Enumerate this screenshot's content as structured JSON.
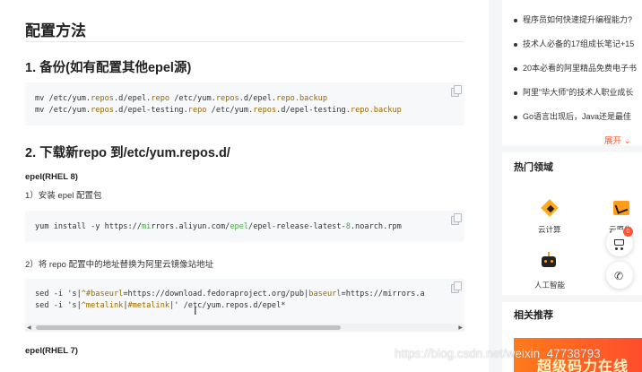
{
  "article": {
    "section_title": "配置方法",
    "backup_heading": "1. 备份(如有配置其他epel源)",
    "download_heading": "2. 下载新repo 到/etc/yum.repos.d/",
    "epel8_label": "epel(RHEL 8)",
    "step1_text": "1）安装 epel 配置包",
    "step2_text": "2）将 repo 配置中的地址替换为阿里云镜像站地址",
    "epel7_label": "epel(RHEL 7)"
  },
  "code_blocks": {
    "backup": {
      "line1": [
        "mv /etc/yum.",
        "repos",
        ".d/epel.",
        "repo",
        " /etc/yum.",
        "repos",
        ".d/epel.",
        "repo",
        ".backup"
      ],
      "line2": [
        "mv /etc/yum.",
        "repos",
        ".d/epel-testing.",
        "repo",
        " /etc/yum.",
        "repos",
        ".d/epel-testing.",
        "repo",
        ".backup"
      ]
    },
    "install": {
      "line1": [
        "yum install -y https://",
        "mi",
        "rrors.aliyun.com/",
        "epel",
        "/epel-release-latest-",
        "8",
        ".noarch.rpm"
      ]
    },
    "sed": {
      "line1": [
        "sed -i 's|",
        "^#baseurl",
        "=https://download.fedoraproject.org/pub|",
        "baseurl",
        "=https://mirrors.a"
      ],
      "line2": [
        "sed -i 's|",
        "^metalink",
        "|",
        "#metalink",
        "|' ",
        "/etc/yum.repos.d/epel*"
      ]
    }
  },
  "sidebar": {
    "recommended_items": [
      "程序员如何快速提升编程能力?",
      "技术人必备的17组成长笔记+15",
      "20本必看的阿里精品免费电子书",
      "阿里\"毕大师\"的技术人职业成长",
      "Go语言出现后，Java还是最佳"
    ],
    "expand_label": "展开",
    "hot_heading": "热门领域",
    "hot_tiles": [
      {
        "label": "云计算",
        "icon": "cloud-compute-icon"
      },
      {
        "label": "云原生",
        "icon": "cloud-native-icon"
      },
      {
        "label": "人工智能",
        "icon": "ai-robot-icon"
      }
    ],
    "related_heading": "相关推荐",
    "cart_badge": "0",
    "banner_text": "超级码力在线"
  },
  "watermark": "https://blog.csdn.net/weixin_47738793",
  "colors": {
    "accent": "#fc5531",
    "code_bg": "#f6f8fa",
    "string": "#986801",
    "green": "#50a14f"
  }
}
